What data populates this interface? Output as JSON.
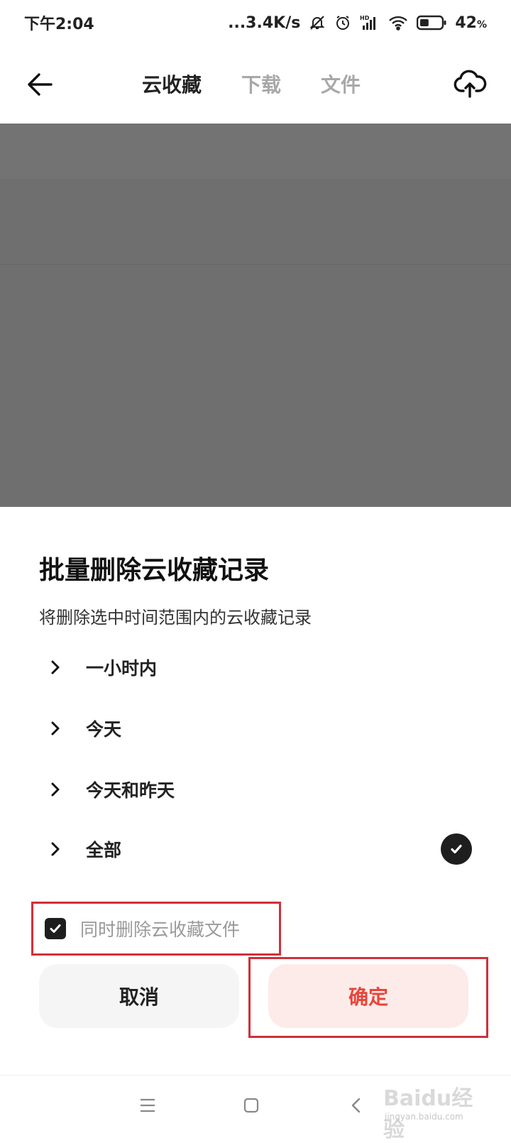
{
  "status_bar": {
    "time": "下午2:04",
    "network_speed": "...3.4K/s",
    "battery": "42",
    "battery_unit": "%",
    "battery_level": 0.42,
    "icons": [
      "bell-off-icon",
      "alarm-icon",
      "hd-signal-icon",
      "wifi-icon",
      "battery-icon"
    ]
  },
  "header": {
    "back_icon": "arrow-left-icon",
    "tabs": [
      {
        "label": "云收藏",
        "active": true
      },
      {
        "label": "下载",
        "active": false
      },
      {
        "label": "文件",
        "active": false
      }
    ],
    "action_icon": "cloud-upload-icon"
  },
  "dialog": {
    "title": "批量删除云收藏记录",
    "subtitle": "将删除选中时间范围内的云收藏记录",
    "options": [
      {
        "label": "一小时内",
        "selected": false
      },
      {
        "label": "今天",
        "selected": false
      },
      {
        "label": "今天和昨天",
        "selected": false
      },
      {
        "label": "全部",
        "selected": true
      }
    ],
    "also_delete_label": "同时删除云收藏文件",
    "also_delete_checked": true,
    "cancel_label": "取消",
    "confirm_label": "确定"
  },
  "watermark": {
    "brand": "Baidu经验",
    "url": "jingyan.baidu.com"
  },
  "colors": {
    "accent": "#e8463b",
    "confirm_bg": "#fdebea",
    "annotation_frame": "#d0303a",
    "overlay": "#6f6f6f"
  }
}
